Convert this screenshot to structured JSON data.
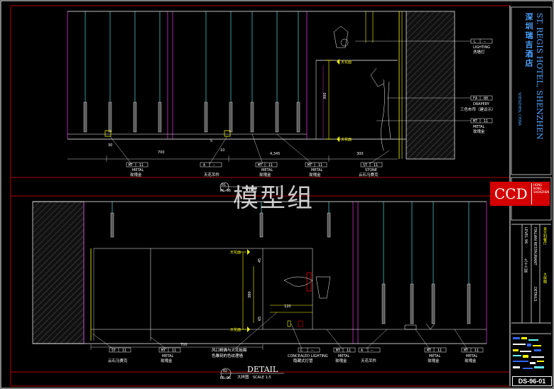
{
  "hotel": {
    "name_cn": "深圳瑞吉酒店",
    "name_en": "ST. REGIS HOTEL, SHENZHEN",
    "city": "SHENZHEN, CHINA"
  },
  "firm": {
    "logo_text": "CCD",
    "side_text": "HONG KONG SHENZHEN"
  },
  "title_block": {
    "area": "意大利餐厅",
    "drawing": "大样图",
    "area_en": "ITALIAN RESTAURANT",
    "detail_en": "DETAILS",
    "level": "LEVEL 96",
    "level_cn": "九十六层",
    "sheet_no": "DS-96-01"
  },
  "watermark": "模型组",
  "detail_top": {
    "number": "01",
    "ref": "RC-96",
    "name": "大样图"
  },
  "detail_bottom": {
    "number": "02",
    "ref": "RC-96",
    "label": "DETAIL",
    "name": "大样图",
    "scale": "SCALE 1:5"
  },
  "top_tags": [
    {
      "code": "MT",
      "num": "11",
      "mat_en": "METAL",
      "mat_cn": "玫瑰金"
    },
    {
      "code": "A",
      "num": "—",
      "mat_en": "",
      "mat_cn": "天花吊件"
    },
    {
      "code": "MT",
      "num": "11",
      "mat_en": "METAL",
      "mat_cn": "玫瑰金"
    },
    {
      "code": "MT",
      "num": "11",
      "mat_en": "METAL",
      "mat_cn": "玫瑰金"
    },
    {
      "code": "ST",
      "num": "11",
      "mat_en": "STONE",
      "mat_cn": "云石马赛克"
    }
  ],
  "right_tags": [
    {
      "code": "L",
      "num": "—",
      "mat_en": "LIGHTING",
      "mat_cn": "洗墙灯"
    },
    {
      "code": "FA",
      "num": "80",
      "mat_en": "DRAPERY",
      "mat_cn": "三色布帘（建议示）"
    },
    {
      "code": "MT",
      "num": "11",
      "mat_en": "METAL",
      "mat_cn": "玫瑰金"
    }
  ],
  "bottom_tags": [
    {
      "code": "ST",
      "num": "11",
      "mat_en": "",
      "mat_cn": "云石马赛克"
    },
    {
      "code": "MT",
      "num": "11",
      "mat_en": "METAL",
      "mat_cn": "玫瑰金"
    },
    {
      "code": "",
      "num": "",
      "mat_en": "",
      "mat_cn": "风口精确与天花板踢"
    },
    {
      "code": "L",
      "num": "—",
      "mat_en": "CONCEALED LIGHTING",
      "mat_cn": "隐藏式灯管"
    },
    {
      "code": "MT",
      "num": "11",
      "mat_en": "METAL",
      "mat_cn": "玫瑰金"
    },
    {
      "code": "A",
      "num": "—",
      "mat_en": "",
      "mat_cn": "天花吊件"
    },
    {
      "code": "MT",
      "num": "11",
      "mat_en": "METAL",
      "mat_cn": "玫瑰金"
    },
    {
      "code": "MT",
      "num": "11",
      "mat_en": "METAL",
      "mat_cn": "玫瑰金"
    }
  ],
  "bottom_extra": "色雕刻的色纹理墙",
  "levels": {
    "top_a": "天花面",
    "top_b": "天花面",
    "bot_a": "天花面",
    "bot_b": "天花面"
  },
  "dims": {
    "d30": "30",
    "d700": "700",
    "d4345": "4,345",
    "d300": "300",
    "d10": "10",
    "d5": "5",
    "d380": "380",
    "d45": "45",
    "d120": "120",
    "d65": "65"
  },
  "colors": {
    "frame_red": "#e00000",
    "line_magenta": "#cc33cc",
    "line_yellow": "#ffff00",
    "line_cyan": "#66ffff",
    "line_blue": "#3366ff",
    "text_white": "#ffffff",
    "hotel_blue": "#4da3ff"
  }
}
